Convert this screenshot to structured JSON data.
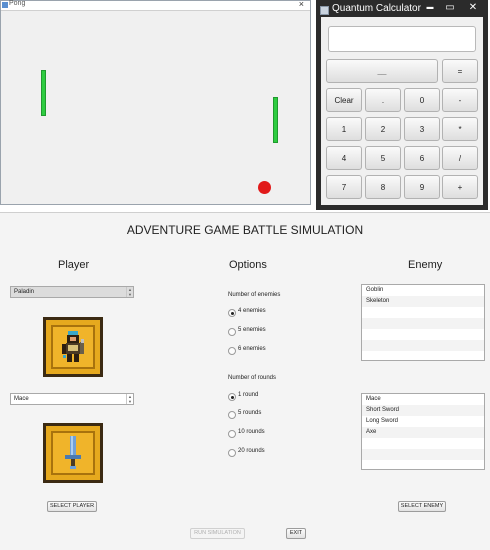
{
  "pong": {
    "title": "Pong",
    "close_icon": "×"
  },
  "calculator": {
    "title": "Quantum Calculator",
    "window_buttons": {
      "minimize": "▬",
      "maximize": "▭",
      "close": "✕"
    },
    "display_value": "",
    "keys": {
      "backspace": "__",
      "equals": "=",
      "clear": "Clear",
      "dot": ".",
      "zero": "0",
      "minus": "-",
      "one": "1",
      "two": "2",
      "three": "3",
      "multiply": "*",
      "four": "4",
      "five": "5",
      "six": "6",
      "divide": "/",
      "seven": "7",
      "eight": "8",
      "nine": "9",
      "plus": "+"
    }
  },
  "adventure": {
    "title": "ADVENTURE GAME BATTLE SIMULATION",
    "player": {
      "heading": "Player",
      "class_value": "Paladin",
      "weapon_value": "Mace",
      "select_button": "SELECT PLAYER"
    },
    "options": {
      "heading": "Options",
      "enemies_label": "Number of enemies",
      "enemies": [
        "4 enemies",
        "5 enemies",
        "6 enemies"
      ],
      "enemies_selected": 0,
      "rounds_label": "Number of rounds",
      "rounds": [
        "1 round",
        "5 rounds",
        "10 rounds",
        "20 rounds"
      ],
      "rounds_selected": 0
    },
    "enemy": {
      "heading": "Enemy",
      "enemy_list": [
        "Goblin",
        "Skeleton"
      ],
      "weapon_list": [
        "Mace",
        "Short Sword",
        "Long Sword",
        "Axe"
      ],
      "select_button": "SELECT ENEMY"
    },
    "run_button": "RUN SIMULATION",
    "exit_button": "EXIT"
  }
}
